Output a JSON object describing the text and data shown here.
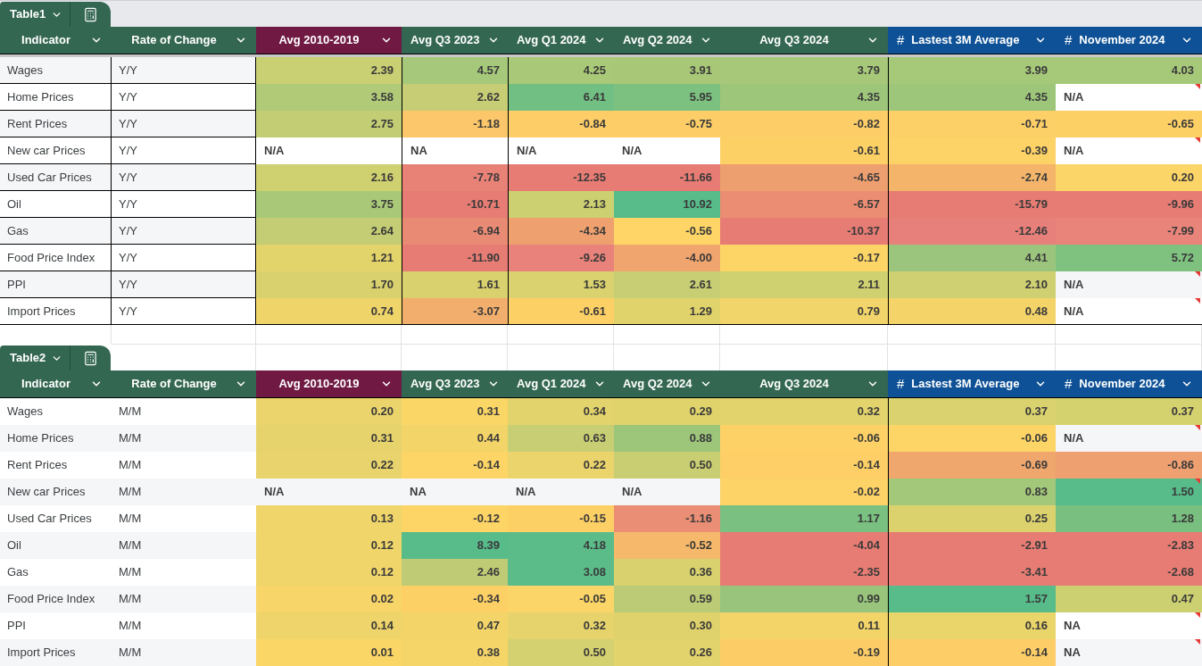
{
  "tables": [
    {
      "tab": {
        "name": "Table1"
      },
      "columns": [
        {
          "label": "Indicator",
          "color": "#346752"
        },
        {
          "label": "Rate of Change",
          "color": "#346752"
        },
        {
          "label": "Avg 2010-2019",
          "color": "#701a43"
        },
        {
          "label": "Avg Q3 2023",
          "color": "#346752"
        },
        {
          "label": "Avg Q1 2024",
          "color": "#346752"
        },
        {
          "label": "Avg Q2 2024",
          "color": "#346752"
        },
        {
          "label": "Avg Q3 2024",
          "color": "#346752"
        },
        {
          "label": "Lastest 3M Average",
          "prefix": "#",
          "color": "#0e5196"
        },
        {
          "label": "November 2024",
          "prefix": "#",
          "color": "#0e5196"
        }
      ],
      "rows": [
        {
          "indicator": "Wages",
          "rate": "Y/Y",
          "cells": [
            {
              "kind": "number",
              "value": "2.39",
              "color": "#c9cf73",
              "flagged": false
            },
            {
              "kind": "number",
              "value": "4.57",
              "color": "#a5c87a",
              "flagged": false
            },
            {
              "kind": "number",
              "value": "4.25",
              "color": "#a9c878",
              "flagged": false
            },
            {
              "kind": "number",
              "value": "3.91",
              "color": "#a8c878",
              "flagged": false
            },
            {
              "kind": "number",
              "value": "3.79",
              "color": "#a7c879",
              "flagged": false
            },
            {
              "kind": "number",
              "value": "3.99",
              "color": "#a6c879",
              "flagged": false
            },
            {
              "kind": "number",
              "value": "4.03",
              "color": "#a6c879",
              "flagged": false
            }
          ]
        },
        {
          "indicator": "Home Prices",
          "rate": "Y/Y",
          "cells": [
            {
              "kind": "number",
              "value": "3.58",
              "color": "#b0ca78",
              "flagged": false
            },
            {
              "kind": "number",
              "value": "2.62",
              "color": "#c6cd75",
              "flagged": false
            },
            {
              "kind": "number",
              "value": "6.41",
              "color": "#72bf84",
              "flagged": false
            },
            {
              "kind": "number",
              "value": "5.95",
              "color": "#7cc180",
              "flagged": false
            },
            {
              "kind": "number",
              "value": "4.35",
              "color": "#9dc67b",
              "flagged": false
            },
            {
              "kind": "number",
              "value": "4.35",
              "color": "#9dc67b",
              "flagged": false
            },
            {
              "kind": "text",
              "value": "N/A",
              "flagged": true
            }
          ]
        },
        {
          "indicator": "Rent Prices",
          "rate": "Y/Y",
          "cells": [
            {
              "kind": "number",
              "value": "2.75",
              "color": "#c3cd74",
              "flagged": false
            },
            {
              "kind": "number",
              "value": "-1.18",
              "color": "#fbc76a",
              "flagged": false
            },
            {
              "kind": "number",
              "value": "-0.84",
              "color": "#fdcd67",
              "flagged": false
            },
            {
              "kind": "number",
              "value": "-0.75",
              "color": "#fdce67",
              "flagged": false
            },
            {
              "kind": "number",
              "value": "-0.82",
              "color": "#fdce67",
              "flagged": false
            },
            {
              "kind": "number",
              "value": "-0.71",
              "color": "#fdcf67",
              "flagged": false
            },
            {
              "kind": "number",
              "value": "-0.65",
              "color": "#fdd066",
              "flagged": false
            }
          ]
        },
        {
          "indicator": "New car Prices",
          "rate": "Y/Y",
          "cells": [
            {
              "kind": "text",
              "value": "N/A",
              "flagged": false
            },
            {
              "kind": "text",
              "value": "NA",
              "flagged": false
            },
            {
              "kind": "text",
              "value": "N/A",
              "flagged": false
            },
            {
              "kind": "text",
              "value": "N/A",
              "flagged": false
            },
            {
              "kind": "number",
              "value": "-0.61",
              "color": "#fdd066",
              "flagged": false
            },
            {
              "kind": "number",
              "value": "-0.39",
              "color": "#fdd266",
              "flagged": false
            },
            {
              "kind": "text",
              "value": "N/A",
              "flagged": true
            }
          ]
        },
        {
          "indicator": "Used Car Prices",
          "rate": "Y/Y",
          "cells": [
            {
              "kind": "number",
              "value": "2.16",
              "color": "#cfd070",
              "flagged": false
            },
            {
              "kind": "number",
              "value": "-7.78",
              "color": "#e98276",
              "flagged": false
            },
            {
              "kind": "number",
              "value": "-12.35",
              "color": "#e67c73",
              "flagged": false
            },
            {
              "kind": "number",
              "value": "-11.66",
              "color": "#e67c73",
              "flagged": false
            },
            {
              "kind": "number",
              "value": "-4.65",
              "color": "#ee9f70",
              "flagged": false
            },
            {
              "kind": "number",
              "value": "-2.74",
              "color": "#f4b56b",
              "flagged": false
            },
            {
              "kind": "number",
              "value": "0.20",
              "color": "#fbd567",
              "flagged": false
            }
          ]
        },
        {
          "indicator": "Oil",
          "rate": "Y/Y",
          "cells": [
            {
              "kind": "number",
              "value": "3.75",
              "color": "#aac978",
              "flagged": false
            },
            {
              "kind": "number",
              "value": "-10.71",
              "color": "#e67c73",
              "flagged": false
            },
            {
              "kind": "number",
              "value": "2.13",
              "color": "#cdd070",
              "flagged": false
            },
            {
              "kind": "number",
              "value": "10.92",
              "color": "#57bb8a",
              "flagged": false
            },
            {
              "kind": "number",
              "value": "-6.57",
              "color": "#eb8d73",
              "flagged": false
            },
            {
              "kind": "number",
              "value": "-15.79",
              "color": "#e67c73",
              "flagged": false
            },
            {
              "kind": "number",
              "value": "-9.96",
              "color": "#e67c73",
              "flagged": false
            }
          ]
        },
        {
          "indicator": "Gas",
          "rate": "Y/Y",
          "cells": [
            {
              "kind": "number",
              "value": "2.64",
              "color": "#c4cd73",
              "flagged": false
            },
            {
              "kind": "number",
              "value": "-6.94",
              "color": "#e98b74",
              "flagged": false
            },
            {
              "kind": "number",
              "value": "-4.34",
              "color": "#eea06f",
              "flagged": false
            },
            {
              "kind": "number",
              "value": "-0.56",
              "color": "#fed566",
              "flagged": false
            },
            {
              "kind": "number",
              "value": "-10.37",
              "color": "#e67c73",
              "flagged": false
            },
            {
              "kind": "number",
              "value": "-12.46",
              "color": "#e7807a",
              "flagged": false
            },
            {
              "kind": "number",
              "value": "-7.99",
              "color": "#e8847a",
              "flagged": false
            }
          ]
        },
        {
          "indicator": "Food Price Index",
          "rate": "Y/Y",
          "cells": [
            {
              "kind": "number",
              "value": "1.21",
              "color": "#e3d36b",
              "flagged": false
            },
            {
              "kind": "number",
              "value": "-11.90",
              "color": "#e67c73",
              "flagged": false
            },
            {
              "kind": "number",
              "value": "-9.26",
              "color": "#e8827a",
              "flagged": false
            },
            {
              "kind": "number",
              "value": "-4.00",
              "color": "#f0a56e",
              "flagged": false
            },
            {
              "kind": "number",
              "value": "-0.17",
              "color": "#fdd566",
              "flagged": false
            },
            {
              "kind": "number",
              "value": "4.41",
              "color": "#9bc57c",
              "flagged": false
            },
            {
              "kind": "number",
              "value": "5.72",
              "color": "#7fc280",
              "flagged": false
            }
          ]
        },
        {
          "indicator": "PPI",
          "rate": "Y/Y",
          "cells": [
            {
              "kind": "number",
              "value": "1.70",
              "color": "#d8d16e",
              "flagged": false
            },
            {
              "kind": "number",
              "value": "1.61",
              "color": "#d8d16e",
              "flagged": false
            },
            {
              "kind": "number",
              "value": "1.53",
              "color": "#d9d26e",
              "flagged": false
            },
            {
              "kind": "number",
              "value": "2.61",
              "color": "#c7ce73",
              "flagged": false
            },
            {
              "kind": "number",
              "value": "2.11",
              "color": "#cfd070",
              "flagged": false
            },
            {
              "kind": "number",
              "value": "2.10",
              "color": "#cfd071",
              "flagged": false
            },
            {
              "kind": "text",
              "value": "N/A",
              "flagged": true
            }
          ]
        },
        {
          "indicator": "Import Prices",
          "rate": "Y/Y",
          "cells": [
            {
              "kind": "number",
              "value": "0.74",
              "color": "#efd46a",
              "flagged": false
            },
            {
              "kind": "number",
              "value": "-3.07",
              "color": "#f2ae6d",
              "flagged": false
            },
            {
              "kind": "number",
              "value": "-0.61",
              "color": "#fdd066",
              "flagged": false
            },
            {
              "kind": "number",
              "value": "1.29",
              "color": "#e1d36b",
              "flagged": false
            },
            {
              "kind": "number",
              "value": "0.79",
              "color": "#f1d46a",
              "flagged": false
            },
            {
              "kind": "number",
              "value": "0.48",
              "color": "#f4d469",
              "flagged": false
            },
            {
              "kind": "text",
              "value": "N/A",
              "flagged": true
            }
          ]
        }
      ]
    },
    {
      "tab": {
        "name": "Table2"
      },
      "columns": [
        {
          "label": "Indicator",
          "color": "#346752"
        },
        {
          "label": "Rate of Change",
          "color": "#346752"
        },
        {
          "label": "Avg 2010-2019",
          "color": "#701a43"
        },
        {
          "label": "Avg Q3 2023",
          "color": "#346752"
        },
        {
          "label": "Avg Q1 2024",
          "color": "#346752"
        },
        {
          "label": "Avg Q2 2024",
          "color": "#346752"
        },
        {
          "label": "Avg Q3 2024",
          "color": "#346752"
        },
        {
          "label": "Lastest 3M Average",
          "prefix": "#",
          "color": "#0e5196"
        },
        {
          "label": "November 2024",
          "prefix": "#",
          "color": "#0e5196"
        }
      ],
      "rows": [
        {
          "indicator": "Wages",
          "rate": "M/M",
          "cells": [
            {
              "kind": "number",
              "value": "0.20",
              "color": "#ebd46c",
              "flagged": false
            },
            {
              "kind": "number",
              "value": "0.31",
              "color": "#fad667",
              "flagged": false
            },
            {
              "kind": "number",
              "value": "0.34",
              "color": "#e3d36c",
              "flagged": false
            },
            {
              "kind": "number",
              "value": "0.29",
              "color": "#e0d36c",
              "flagged": false
            },
            {
              "kind": "number",
              "value": "0.32",
              "color": "#e2d36c",
              "flagged": false
            },
            {
              "kind": "number",
              "value": "0.37",
              "color": "#d9d26e",
              "flagged": false
            },
            {
              "kind": "number",
              "value": "0.37",
              "color": "#d4d16f",
              "flagged": false
            }
          ]
        },
        {
          "indicator": "Home Prices",
          "rate": "M/M",
          "cells": [
            {
              "kind": "number",
              "value": "0.31",
              "color": "#e6d36c",
              "flagged": false
            },
            {
              "kind": "number",
              "value": "0.44",
              "color": "#f3d469",
              "flagged": false
            },
            {
              "kind": "number",
              "value": "0.63",
              "color": "#c8ce73",
              "flagged": false
            },
            {
              "kind": "number",
              "value": "0.88",
              "color": "#9dc67b",
              "flagged": false
            },
            {
              "kind": "number",
              "value": "-0.06",
              "color": "#fdd166",
              "flagged": false
            },
            {
              "kind": "number",
              "value": "-0.06",
              "color": "#fdd466",
              "flagged": false
            },
            {
              "kind": "text",
              "value": "N/A",
              "flagged": true
            }
          ]
        },
        {
          "indicator": "Rent Prices",
          "rate": "M/M",
          "cells": [
            {
              "kind": "number",
              "value": "0.22",
              "color": "#e8d36c",
              "flagged": false
            },
            {
              "kind": "number",
              "value": "-0.14",
              "color": "#fdd466",
              "flagged": false
            },
            {
              "kind": "number",
              "value": "0.22",
              "color": "#ebd46b",
              "flagged": false
            },
            {
              "kind": "number",
              "value": "0.50",
              "color": "#c9ce72",
              "flagged": false
            },
            {
              "kind": "number",
              "value": "-0.14",
              "color": "#fdcf66",
              "flagged": false
            },
            {
              "kind": "number",
              "value": "-0.69",
              "color": "#f0a76e",
              "flagged": false
            },
            {
              "kind": "number",
              "value": "-0.86",
              "color": "#eea070",
              "flagged": false
            }
          ]
        },
        {
          "indicator": "New car Prices",
          "rate": "M/M",
          "cells": [
            {
              "kind": "text",
              "value": "N/A",
              "flagged": false
            },
            {
              "kind": "text",
              "value": "NA",
              "flagged": false
            },
            {
              "kind": "text",
              "value": "N/A",
              "flagged": false
            },
            {
              "kind": "text",
              "value": "N/A",
              "flagged": false
            },
            {
              "kind": "number",
              "value": "-0.02",
              "color": "#fdd266",
              "flagged": false
            },
            {
              "kind": "number",
              "value": "0.83",
              "color": "#a4c87a",
              "flagged": false
            },
            {
              "kind": "number",
              "value": "1.50",
              "color": "#57bb8a",
              "flagged": true
            }
          ]
        },
        {
          "indicator": "Used Car Prices",
          "rate": "M/M",
          "cells": [
            {
              "kind": "number",
              "value": "0.13",
              "color": "#f0d56a",
              "flagged": false
            },
            {
              "kind": "number",
              "value": "-0.12",
              "color": "#fdd466",
              "flagged": false
            },
            {
              "kind": "number",
              "value": "-0.15",
              "color": "#fdd066",
              "flagged": false
            },
            {
              "kind": "number",
              "value": "-1.16",
              "color": "#ea8e75",
              "flagged": false
            },
            {
              "kind": "number",
              "value": "1.17",
              "color": "#7ac080",
              "flagged": false
            },
            {
              "kind": "number",
              "value": "0.25",
              "color": "#dcd26d",
              "flagged": false
            },
            {
              "kind": "number",
              "value": "1.28",
              "color": "#78bf80",
              "flagged": false
            }
          ]
        },
        {
          "indicator": "Oil",
          "rate": "M/M",
          "cells": [
            {
              "kind": "number",
              "value": "0.12",
              "color": "#f0d56a",
              "flagged": false
            },
            {
              "kind": "number",
              "value": "8.39",
              "color": "#57bb8a",
              "flagged": false
            },
            {
              "kind": "number",
              "value": "4.18",
              "color": "#5bbc89",
              "flagged": false
            },
            {
              "kind": "number",
              "value": "-0.52",
              "color": "#f6b86b",
              "flagged": false
            },
            {
              "kind": "number",
              "value": "-4.04",
              "color": "#e67c73",
              "flagged": false
            },
            {
              "kind": "number",
              "value": "-2.91",
              "color": "#e67c73",
              "flagged": false
            },
            {
              "kind": "number",
              "value": "-2.83",
              "color": "#e67c73",
              "flagged": false
            }
          ]
        },
        {
          "indicator": "Gas",
          "rate": "M/M",
          "cells": [
            {
              "kind": "number",
              "value": "0.12",
              "color": "#f0d56a",
              "flagged": false
            },
            {
              "kind": "number",
              "value": "2.46",
              "color": "#c0cc75",
              "flagged": false
            },
            {
              "kind": "number",
              "value": "3.08",
              "color": "#5bbc89",
              "flagged": false
            },
            {
              "kind": "number",
              "value": "0.36",
              "color": "#d8d16e",
              "flagged": false
            },
            {
              "kind": "number",
              "value": "-2.35",
              "color": "#e67c73",
              "flagged": false
            },
            {
              "kind": "number",
              "value": "-3.41",
              "color": "#e67c73",
              "flagged": false
            },
            {
              "kind": "number",
              "value": "-2.68",
              "color": "#e67c73",
              "flagged": false
            }
          ]
        },
        {
          "indicator": "Food Price Index",
          "rate": "M/M",
          "cells": [
            {
              "kind": "number",
              "value": "0.02",
              "color": "#f8d568",
              "flagged": false
            },
            {
              "kind": "number",
              "value": "-0.34",
              "color": "#fdd066",
              "flagged": false
            },
            {
              "kind": "number",
              "value": "-0.05",
              "color": "#fbd567",
              "flagged": false
            },
            {
              "kind": "number",
              "value": "0.59",
              "color": "#bccb76",
              "flagged": false
            },
            {
              "kind": "number",
              "value": "0.99",
              "color": "#98c57b",
              "flagged": false
            },
            {
              "kind": "number",
              "value": "1.57",
              "color": "#57bb8a",
              "flagged": false
            },
            {
              "kind": "number",
              "value": "0.47",
              "color": "#cdd071",
              "flagged": false
            }
          ]
        },
        {
          "indicator": "PPI",
          "rate": "M/M",
          "cells": [
            {
              "kind": "number",
              "value": "0.14",
              "color": "#eed46a",
              "flagged": false
            },
            {
              "kind": "number",
              "value": "0.47",
              "color": "#f3d469",
              "flagged": false
            },
            {
              "kind": "number",
              "value": "0.32",
              "color": "#e6d36c",
              "flagged": false
            },
            {
              "kind": "number",
              "value": "0.30",
              "color": "#dfd26c",
              "flagged": false
            },
            {
              "kind": "number",
              "value": "0.11",
              "color": "#f2d469",
              "flagged": false
            },
            {
              "kind": "number",
              "value": "0.16",
              "color": "#ead56a",
              "flagged": false
            },
            {
              "kind": "text",
              "value": "NA",
              "flagged": true
            }
          ]
        },
        {
          "indicator": "Import Prices",
          "rate": "M/M",
          "cells": [
            {
              "kind": "number",
              "value": "0.01",
              "color": "#fad667",
              "flagged": false
            },
            {
              "kind": "number",
              "value": "0.38",
              "color": "#f5d468",
              "flagged": false
            },
            {
              "kind": "number",
              "value": "0.50",
              "color": "#d4d170",
              "flagged": false
            },
            {
              "kind": "number",
              "value": "0.26",
              "color": "#e3d36c",
              "flagged": false
            },
            {
              "kind": "number",
              "value": "-0.19",
              "color": "#fccd67",
              "flagged": false
            },
            {
              "kind": "number",
              "value": "-0.14",
              "color": "#fdcd67",
              "flagged": false
            },
            {
              "kind": "text",
              "value": "NA",
              "flagged": true
            }
          ]
        }
      ]
    }
  ]
}
